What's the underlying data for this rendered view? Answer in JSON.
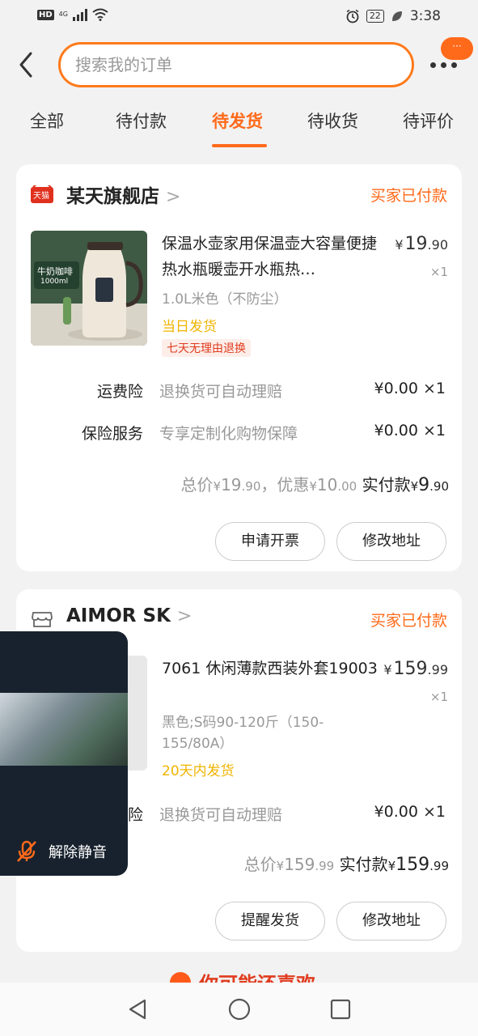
{
  "status_bar": {
    "hd": "HD",
    "network": "4G",
    "battery": "22",
    "time": "3:38"
  },
  "search": {
    "placeholder": "搜索我的订单",
    "badge": "···"
  },
  "tabs": [
    {
      "label": "全部"
    },
    {
      "label": "待付款"
    },
    {
      "label": "待发货"
    },
    {
      "label": "待收货"
    },
    {
      "label": "待评价"
    }
  ],
  "orders": [
    {
      "store_name": "某天旗舰店",
      "store_badge": "天猫",
      "status": "买家已付款",
      "product": {
        "title": "保温水壶家用保温壶大容量便捷热水瓶暖壶开水瓶热…",
        "price_currency": "¥",
        "price_int": "19",
        "price_dec": ".90",
        "qty": "×1",
        "spec": "1.0L米色（不防尘）",
        "shipping": "当日发货",
        "tag": "七天无理由退换",
        "image_label": "牛奶咖啡",
        "image_sub": "1000ml"
      },
      "services": [
        {
          "label": "运费险",
          "desc": "退换货可自动理赔",
          "price": "¥0.00 ×1"
        },
        {
          "label": "保险服务",
          "desc": "专享定制化购物保障",
          "price": "¥0.00 ×1"
        }
      ],
      "total": {
        "total_label": "总价",
        "total_int": "19",
        "total_dec": ".90",
        "discount_label": "，优惠",
        "discount_int": "10",
        "discount_dec": ".00",
        "paid_label": "实付款",
        "paid_int": "9",
        "paid_dec": ".90",
        "currency": "¥"
      },
      "buttons": [
        "申请开票",
        "修改地址"
      ]
    },
    {
      "store_name": "AIMOR SK",
      "status": "买家已付款",
      "product": {
        "title": "7061 休闲薄款西装外套19003",
        "price_currency": "¥",
        "price_int": "159",
        "price_dec": ".99",
        "qty": "×1",
        "spec": "黑色;S码90-120斤（150-155/80A）",
        "shipping": "20天内发货"
      },
      "services": [
        {
          "label": "运费险",
          "desc": "退换货可自动理赔",
          "price": "¥0.00 ×1"
        }
      ],
      "total": {
        "total_label": "总价",
        "total_int": "159",
        "total_dec": ".99",
        "paid_label": "实付款",
        "paid_int": "159",
        "paid_dec": ".99",
        "currency": "¥"
      },
      "buttons": [
        "提醒发货",
        "修改地址"
      ]
    }
  ],
  "float_video": {
    "unmute_label": "解除静音"
  },
  "recommend": {
    "label": "你可能还喜欢"
  },
  "colors": {
    "accent": "#ff6a1a",
    "shipping": "#f0b400",
    "tag_red": "#e03c1f"
  }
}
